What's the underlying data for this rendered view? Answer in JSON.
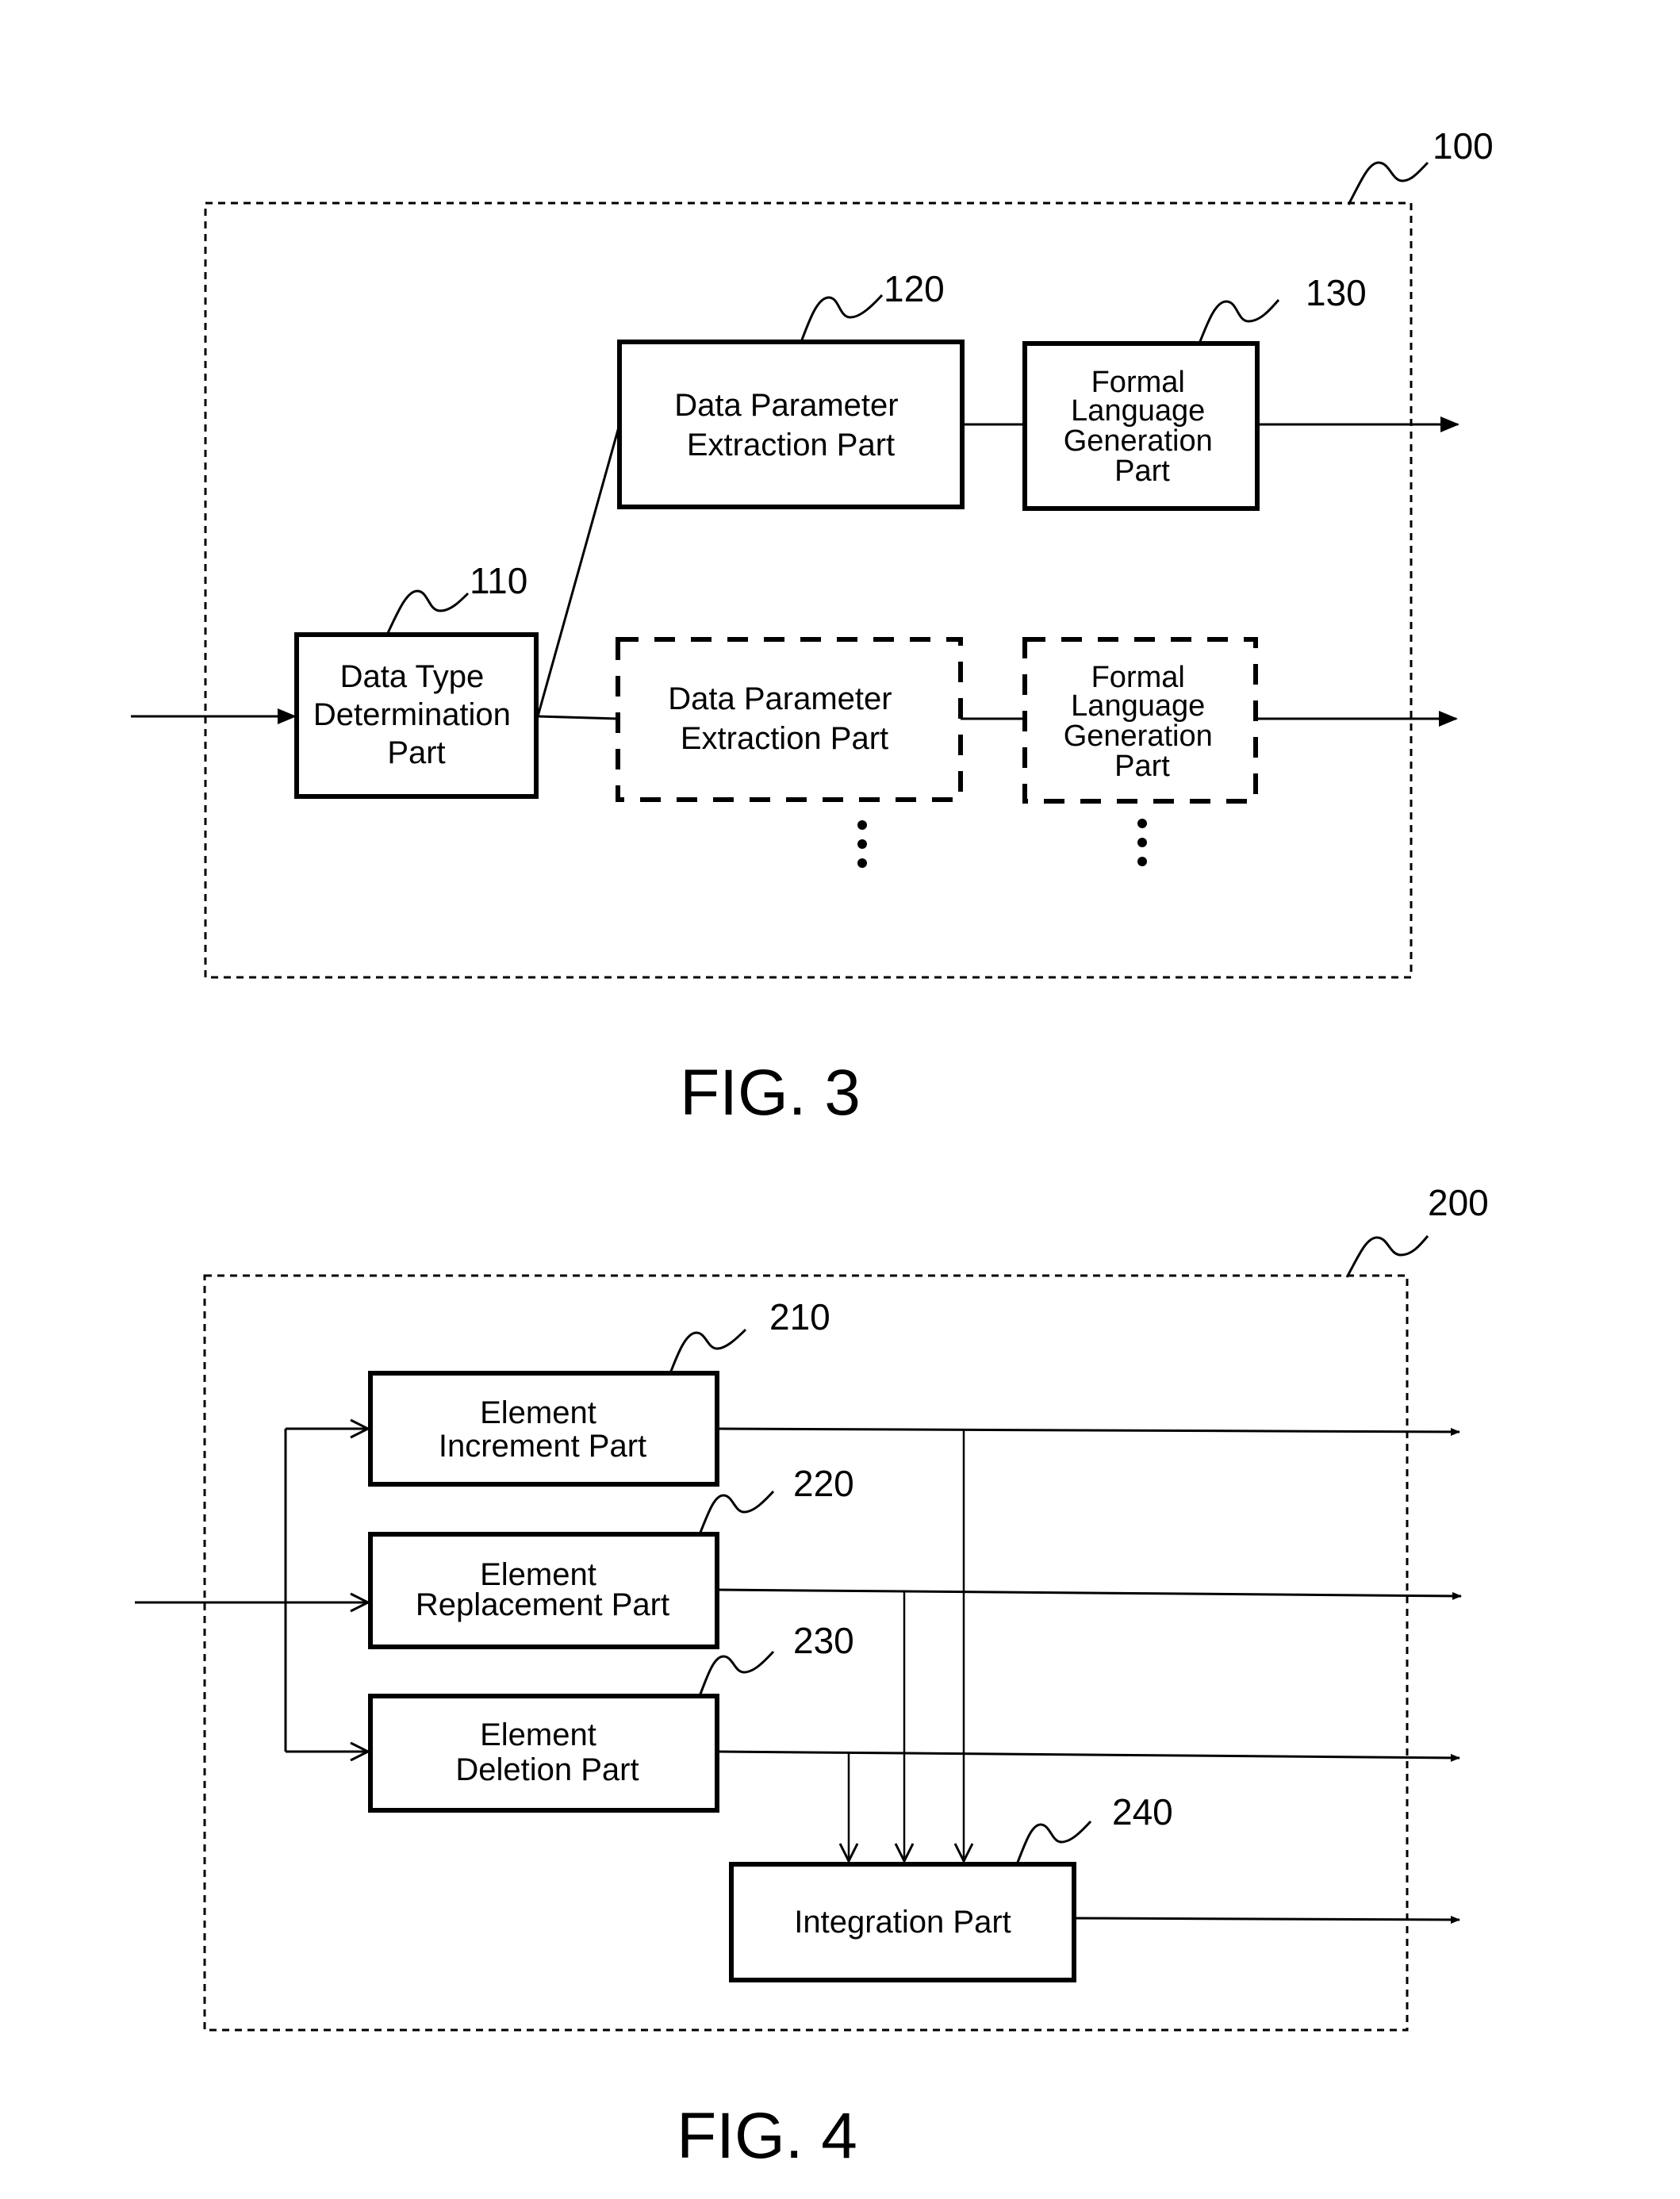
{
  "fig3": {
    "caption": "FIG. 3",
    "container_ref": "100",
    "blocks": {
      "data_type": {
        "ref": "110",
        "lines": [
          "Data Type",
          "Determination",
          "Part"
        ]
      },
      "param_extract": {
        "ref": "120",
        "lines": [
          "Data Parameter",
          "Extraction Part"
        ]
      },
      "formal_lang": {
        "ref": "130",
        "lines": [
          "Formal",
          "Language",
          "Generation",
          "Part"
        ]
      },
      "param_extract_dashed": {
        "lines": [
          "Data Parameter",
          "Extraction Part"
        ]
      },
      "formal_lang_dashed": {
        "lines": [
          "Formal",
          "Language",
          "Generation",
          "Part"
        ]
      }
    },
    "continuation": "⋮"
  },
  "fig4": {
    "caption": "FIG. 4",
    "container_ref": "200",
    "blocks": {
      "increment": {
        "ref": "210",
        "lines": [
          "Element",
          "Increment Part"
        ]
      },
      "replacement": {
        "ref": "220",
        "lines": [
          "Element",
          "Replacement Part"
        ]
      },
      "deletion": {
        "ref": "230",
        "lines": [
          "Element",
          "Deletion Part"
        ]
      },
      "integration": {
        "ref": "240",
        "lines": [
          "Integration Part"
        ]
      }
    }
  }
}
